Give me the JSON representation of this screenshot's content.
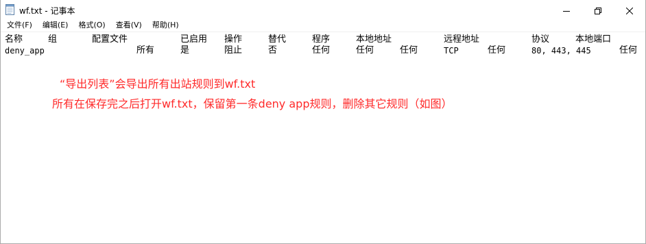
{
  "window": {
    "title": "wf.txt - 记事本",
    "icons": {
      "app": "notepad-icon",
      "minimize": "minimize-icon",
      "maximize": "maximize-icon",
      "close": "close-icon"
    }
  },
  "menu": {
    "items": [
      {
        "label": "文件(F)"
      },
      {
        "label": "编辑(E)"
      },
      {
        "label": "格式(O)"
      },
      {
        "label": "查看(V)"
      },
      {
        "label": "帮助(H)"
      }
    ]
  },
  "document": {
    "columns": [
      "名称",
      "组",
      "配置文件",
      "已启用",
      "操作",
      "替代",
      "程序",
      "本地地址",
      "远程地址",
      "协议",
      "本地端口"
    ],
    "row": {
      "name": "deny_app",
      "profile": "所有",
      "enabled": "是",
      "action": "阻止",
      "override": "否",
      "program": "任何",
      "local_address": "任何",
      "remote_address_1": "任何",
      "protocol": "TCP",
      "remote_address_2": "任何",
      "local_port": "80, 443, 445",
      "trailing": "任何"
    }
  },
  "annotation": {
    "line1": "“导出列表”会导出所有出站规则到wf.txt",
    "line2": "所有在保存完之后打开wf.txt，保留第一条deny app规则，删除其它规则（如图）",
    "color": "#ff2a2a"
  }
}
